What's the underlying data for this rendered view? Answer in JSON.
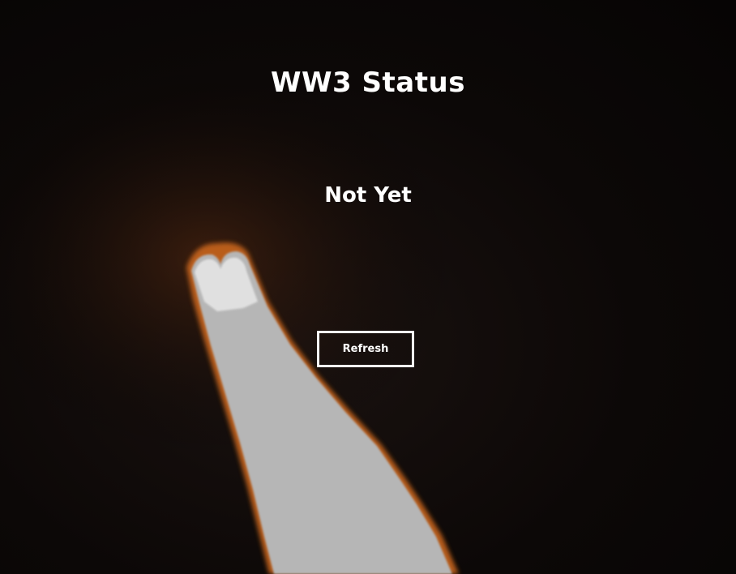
{
  "page": {
    "title": "WW3 Status",
    "status_text": "Not Yet",
    "refresh_label": "Refresh"
  },
  "background": {
    "subject": "rocket-exhaust-plume-at-night",
    "colors": {
      "sky": "#0a0606",
      "plume_core": "#b8b8b8",
      "plume_edge": "#d97a2a"
    }
  },
  "colors": {
    "text": "#ffffff",
    "button_border": "#ffffff"
  }
}
